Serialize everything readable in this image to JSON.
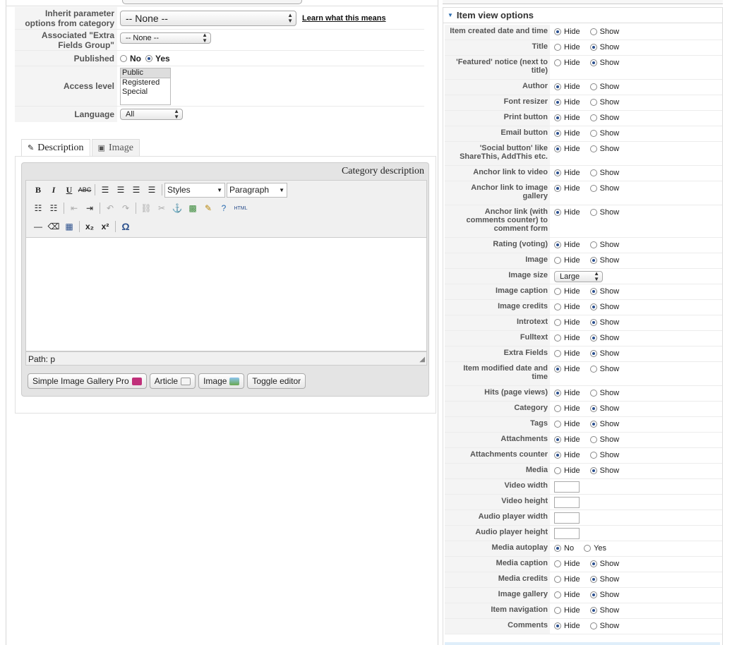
{
  "left_params": {
    "inherit_label": "Inherit parameter options from category",
    "inherit_value": "-- None --",
    "learn_link": "Learn what this means",
    "extra_fields_label": "Associated \"Extra Fields Group\"",
    "extra_fields_value": "-- None --",
    "published_label": "Published",
    "published_no": "No",
    "published_yes": "Yes",
    "access_label": "Access level",
    "access_options": [
      "Public",
      "Registered",
      "Special"
    ],
    "language_label": "Language",
    "language_value": "All"
  },
  "tabs": [
    {
      "label": "Description",
      "icon": "edit-icon"
    },
    {
      "label": "Image",
      "icon": "image-icon"
    }
  ],
  "editor": {
    "caption": "Category description",
    "styles_value": "Styles",
    "format_value": "Paragraph",
    "html_label": "HTML",
    "path": "Path: p",
    "buttons": {
      "gallery": "Simple Image Gallery Pro",
      "article": "Article",
      "image": "Image",
      "toggle": "Toggle editor"
    }
  },
  "item_view": {
    "title": "Item view options",
    "hide": "Hide",
    "show": "Show",
    "no": "No",
    "yes": "Yes",
    "image_size_value": "Large",
    "rows": [
      {
        "label": "Item created date and time",
        "kind": "hs",
        "value": "Hide"
      },
      {
        "label": "Title",
        "kind": "hs",
        "value": "Show"
      },
      {
        "label": "'Featured' notice (next to title)",
        "kind": "hs",
        "value": "Show"
      },
      {
        "label": "Author",
        "kind": "hs",
        "value": "Hide"
      },
      {
        "label": "Font resizer",
        "kind": "hs",
        "value": "Hide"
      },
      {
        "label": "Print button",
        "kind": "hs",
        "value": "Hide"
      },
      {
        "label": "Email button",
        "kind": "hs",
        "value": "Hide"
      },
      {
        "label": "'Social button' like ShareThis, AddThis etc.",
        "kind": "hs",
        "value": "Hide"
      },
      {
        "label": "Anchor link to video",
        "kind": "hs",
        "value": "Hide"
      },
      {
        "label": "Anchor link to image gallery",
        "kind": "hs",
        "value": "Hide"
      },
      {
        "label": "Anchor link (with comments counter) to comment form",
        "kind": "hs",
        "value": "Hide"
      },
      {
        "label": "Rating (voting)",
        "kind": "hs",
        "value": "Hide"
      },
      {
        "label": "Image",
        "kind": "hs",
        "value": "Show"
      },
      {
        "label": "Image size",
        "kind": "select",
        "value": "Large"
      },
      {
        "label": "Image caption",
        "kind": "hs",
        "value": "Show"
      },
      {
        "label": "Image credits",
        "kind": "hs",
        "value": "Show"
      },
      {
        "label": "Introtext",
        "kind": "hs",
        "value": "Show"
      },
      {
        "label": "Fulltext",
        "kind": "hs",
        "value": "Show"
      },
      {
        "label": "Extra Fields",
        "kind": "hs",
        "value": "Show"
      },
      {
        "label": "Item modified date and time",
        "kind": "hs",
        "value": "Hide"
      },
      {
        "label": "Hits (page views)",
        "kind": "hs",
        "value": "Hide"
      },
      {
        "label": "Category",
        "kind": "hs",
        "value": "Show"
      },
      {
        "label": "Tags",
        "kind": "hs",
        "value": "Show"
      },
      {
        "label": "Attachments",
        "kind": "hs",
        "value": "Hide"
      },
      {
        "label": "Attachments counter",
        "kind": "hs",
        "value": "Hide"
      },
      {
        "label": "Media",
        "kind": "hs",
        "value": "Show"
      },
      {
        "label": "Video width",
        "kind": "text",
        "value": ""
      },
      {
        "label": "Video height",
        "kind": "text",
        "value": ""
      },
      {
        "label": "Audio player width",
        "kind": "text",
        "value": ""
      },
      {
        "label": "Audio player height",
        "kind": "text",
        "value": ""
      },
      {
        "label": "Media autoplay",
        "kind": "ny",
        "value": "No"
      },
      {
        "label": "Media caption",
        "kind": "hs",
        "value": "Show"
      },
      {
        "label": "Media credits",
        "kind": "hs",
        "value": "Show"
      },
      {
        "label": "Image gallery",
        "kind": "hs",
        "value": "Show"
      },
      {
        "label": "Item navigation",
        "kind": "hs",
        "value": "Show"
      },
      {
        "label": "Comments",
        "kind": "hs",
        "value": "Hide"
      }
    ]
  }
}
